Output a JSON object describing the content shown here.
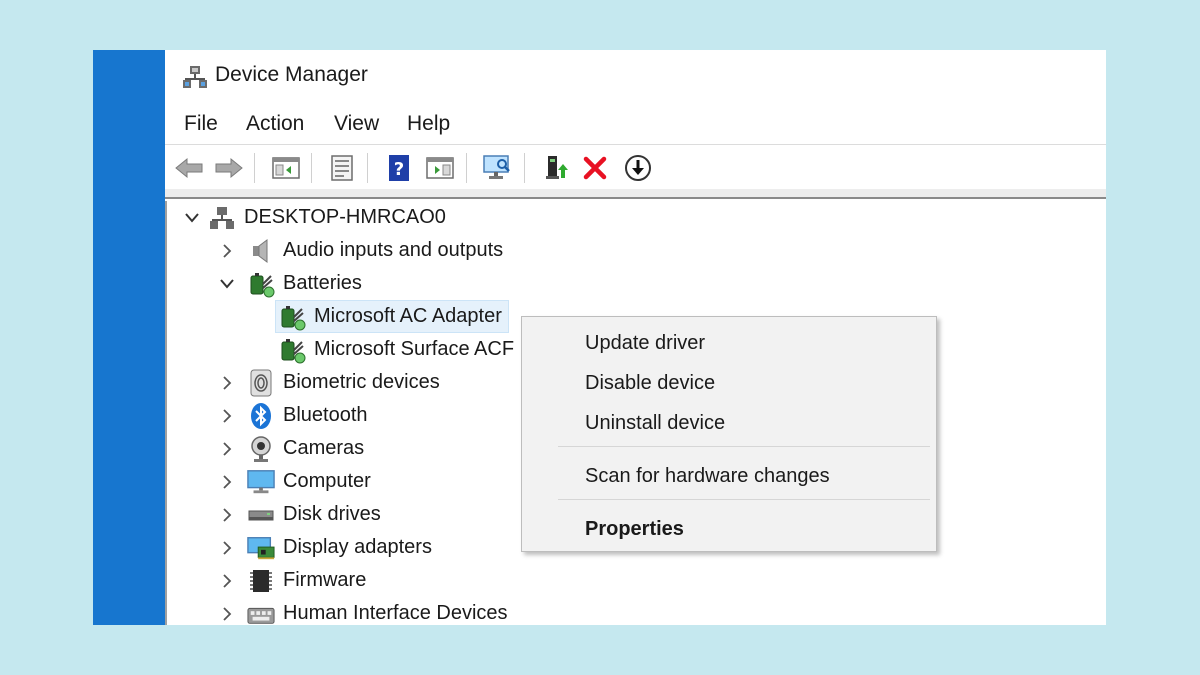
{
  "window": {
    "title": "Device Manager",
    "title_icon": "device-manager-icon"
  },
  "menu": {
    "items": [
      "File",
      "Action",
      "View",
      "Help"
    ]
  },
  "toolbar": {
    "buttons": [
      "back-arrow-icon",
      "forward-arrow-icon",
      "show-hide-console-tree-icon",
      "properties-icon",
      "help-icon",
      "show-hide-action-pane-icon",
      "scan-hardware-icon",
      "update-driver-icon",
      "uninstall-icon",
      "disable-icon"
    ],
    "colors": {
      "uninstall_red": "#e81123",
      "help_blue": "#1f3fa8"
    }
  },
  "tree": {
    "root": "DESKTOP-HMRCAO0",
    "categories": [
      {
        "label": "Audio inputs and outputs",
        "icon": "speaker-icon",
        "expanded": false
      },
      {
        "label": "Batteries",
        "icon": "battery-icon",
        "expanded": true,
        "children": [
          "Microsoft AC Adapter",
          "Microsoft Surface ACPI-Compliant Control Method Battery"
        ],
        "visible_children": [
          "Microsoft AC Adapter",
          "Microsoft Surface ACF"
        ]
      },
      {
        "label": "Biometric devices",
        "icon": "fingerprint-icon",
        "expanded": false
      },
      {
        "label": "Bluetooth",
        "icon": "bluetooth-icon",
        "expanded": false
      },
      {
        "label": "Cameras",
        "icon": "camera-icon",
        "expanded": false
      },
      {
        "label": "Computer",
        "icon": "monitor-icon",
        "expanded": false
      },
      {
        "label": "Disk drives",
        "icon": "disk-drive-icon",
        "expanded": false
      },
      {
        "label": "Display adapters",
        "icon": "display-adapter-icon",
        "expanded": false
      },
      {
        "label": "Firmware",
        "icon": "firmware-chip-icon",
        "expanded": false
      },
      {
        "label": "Human Interface Devices",
        "icon": "hid-icon",
        "expanded": false
      }
    ],
    "selected": "Microsoft AC Adapter"
  },
  "context_menu": {
    "items": [
      "Update driver",
      "Disable device",
      "Uninstall device",
      "Scan for hardware changes",
      "Properties"
    ],
    "bold_item": "Properties"
  },
  "colors": {
    "background": "#c5e8ef",
    "accent_bar": "#1776cf",
    "selection": "#e5f1fb",
    "bluetooth": "#1b74d6"
  }
}
